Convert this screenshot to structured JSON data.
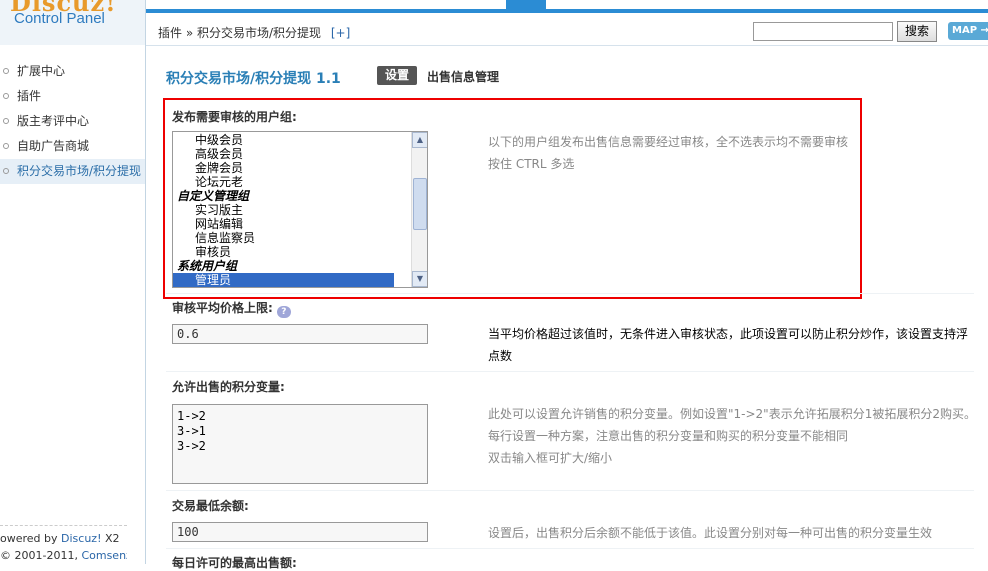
{
  "sidebar": {
    "logo": "Discuz!",
    "subtitle": "Control Panel",
    "items": [
      {
        "label": "扩展中心"
      },
      {
        "label": "插件"
      },
      {
        "label": "版主考评中心"
      },
      {
        "label": "自助广告商城"
      },
      {
        "label": "积分交易市场/积分提现"
      }
    ],
    "footer": {
      "powered_prefix": "owered by",
      "powered_link": "Discuz!",
      "powered_suffix": "X2",
      "copy_prefix": "© 2001-2011,",
      "copy_link": "Comsenz Inc."
    }
  },
  "header": {
    "breadcrumb": "插件 » 积分交易市场/积分提现",
    "add_label": "[+]",
    "search_placeholder": "",
    "search_button": "搜索",
    "map_button": "MAP"
  },
  "page": {
    "title": "积分交易市场/积分提现 1.1",
    "tab_settings": "设置",
    "tab_manage": "出售信息管理"
  },
  "fields": {
    "audit_groups": {
      "label": "发布需要审核的用户组:",
      "options": [
        {
          "text": "中级会员",
          "type": "child"
        },
        {
          "text": "高级会员",
          "type": "child"
        },
        {
          "text": "金牌会员",
          "type": "child"
        },
        {
          "text": "论坛元老",
          "type": "child"
        },
        {
          "text": "自定义管理组",
          "type": "group"
        },
        {
          "text": "实习版主",
          "type": "child"
        },
        {
          "text": "网站编辑",
          "type": "child"
        },
        {
          "text": "信息监察员",
          "type": "child"
        },
        {
          "text": "审核员",
          "type": "child"
        },
        {
          "text": "系统用户组",
          "type": "group"
        },
        {
          "text": "管理员",
          "type": "child",
          "selected": true
        }
      ],
      "desc_line1": "以下的用户组发布出售信息需要经过审核，全不选表示均不需要审核",
      "desc_line2": "按住 CTRL 多选"
    },
    "avg_price": {
      "label": "审核平均价格上限:",
      "help_icon": "question-icon",
      "value": "0.6",
      "desc": "当平均价格超过该值时，无条件进入审核状态，此项设置可以防止积分炒作，该设置支持浮点数"
    },
    "credit_vars": {
      "label": "允许出售的积分变量:",
      "value": "1->2\n3->1\n3->2",
      "desc_line1": "此处可以设置允许销售的积分变量。例如设置\"1->2\"表示允许拓展积分1被拓展积分2购买。每行设置一种方案，注意出售的积分变量和购买的积分变量不能相同",
      "desc_line2": "双击输入框可扩大/缩小"
    },
    "min_balance": {
      "label": "交易最低余额:",
      "value": "100",
      "desc": "设置后，出售积分后余额不能低于该值。此设置分别对每一种可出售的积分变量生效"
    },
    "next_label": "每日许可的最高出售额:"
  },
  "colors": {
    "accent": "#2b8cd4",
    "title": "#2a7fb6",
    "highlight_box": "#e00000",
    "selected": "#316ac5"
  }
}
